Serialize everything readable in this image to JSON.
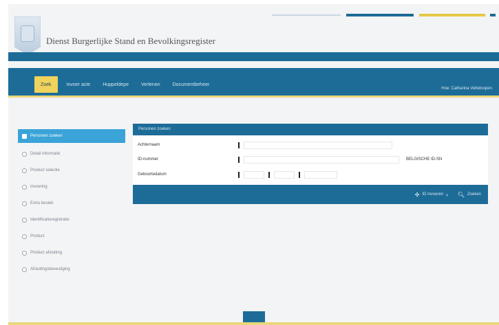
{
  "site": {
    "title": "Dienst Burgerlijke Stand en Bevolkingsregister"
  },
  "nav": {
    "items": [
      "Zoek",
      "Invoer acte",
      "Huppeldepe",
      "Verlenen",
      "Documentbeheer"
    ],
    "active_index": 0,
    "user_link": "Hoe: Catharina Vetteloopen"
  },
  "sidebar": {
    "items": [
      "Personen zoeken",
      "Detail informatie",
      "Product selectie",
      "Invoering",
      "Extra bestek",
      "Identificatieregistratie",
      "Product",
      "Product afsluiting",
      "Afsluitingsbevestiging"
    ],
    "active_index": 0
  },
  "panel": {
    "title": "Personen zoeken",
    "fields": {
      "achternaam_label": "Achternaam",
      "id_label": "ID-nummer",
      "id_note": "BELGISCHE ID-SN",
      "geboortedatum_label": "Geboortedatum"
    }
  },
  "actions": {
    "clear_label": "ID invoeren",
    "search_label": "Zoeken"
  },
  "colors": {
    "primary": "#1d6c98",
    "accent": "#f0d35c",
    "sidebar_active": "#3aa3d8"
  }
}
